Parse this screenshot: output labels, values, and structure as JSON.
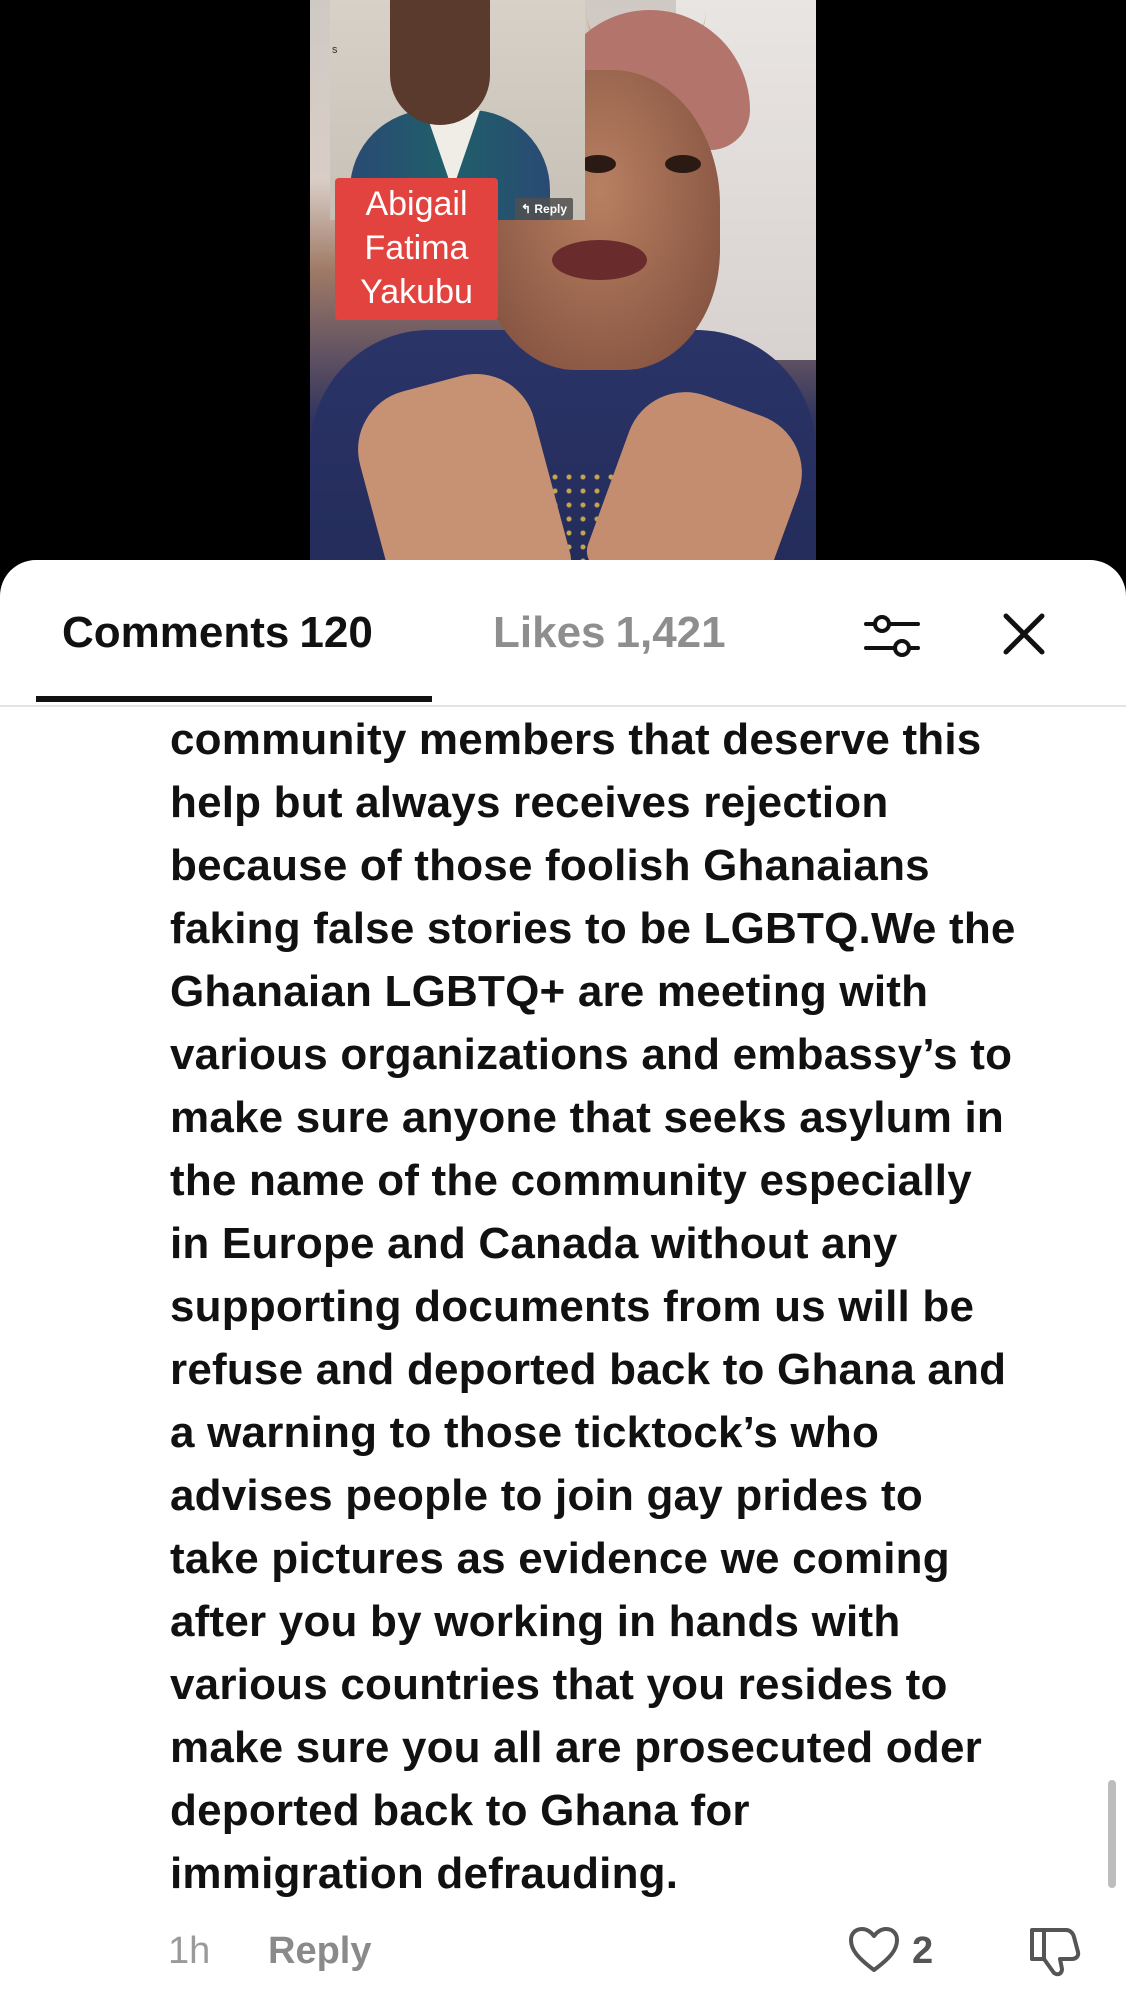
{
  "video": {
    "inset_letter": "s",
    "reply_tag": "Reply",
    "name_badge": [
      "Abigail",
      "Fatima",
      "Yakubu"
    ]
  },
  "tabs": {
    "comments_label": "Comments",
    "comments_count": "120",
    "likes_label": "Likes",
    "likes_count": "1,421"
  },
  "comment": {
    "lines": [
      "community members that deserve this",
      "help but always receives rejection",
      "because of those foolish Ghanaians",
      "faking false stories to be LGBTQ.We the",
      "Ghanaian LGBTQ+ are meeting with",
      "various organizations and embassy’s to",
      "make sure anyone that seeks asylum in",
      "the name of the community especially",
      "in Europe and Canada without any",
      "supporting documents from us will be",
      "refuse and deported back to Ghana and",
      "a warning to those ticktock’s who",
      "advises people to join gay prides to",
      "take pictures as evidence we coming",
      "after you by working in hands with",
      "various countries that you resides to",
      "make sure you all are prosecuted oder",
      "deported back to Ghana for",
      "immigration defrauding."
    ],
    "time": "1h",
    "reply_label": "Reply",
    "like_count": "2"
  },
  "icons": {
    "filter": "sliders-icon",
    "close": "close-icon",
    "like": "heart-icon",
    "dislike": "thumbs-down-icon"
  }
}
